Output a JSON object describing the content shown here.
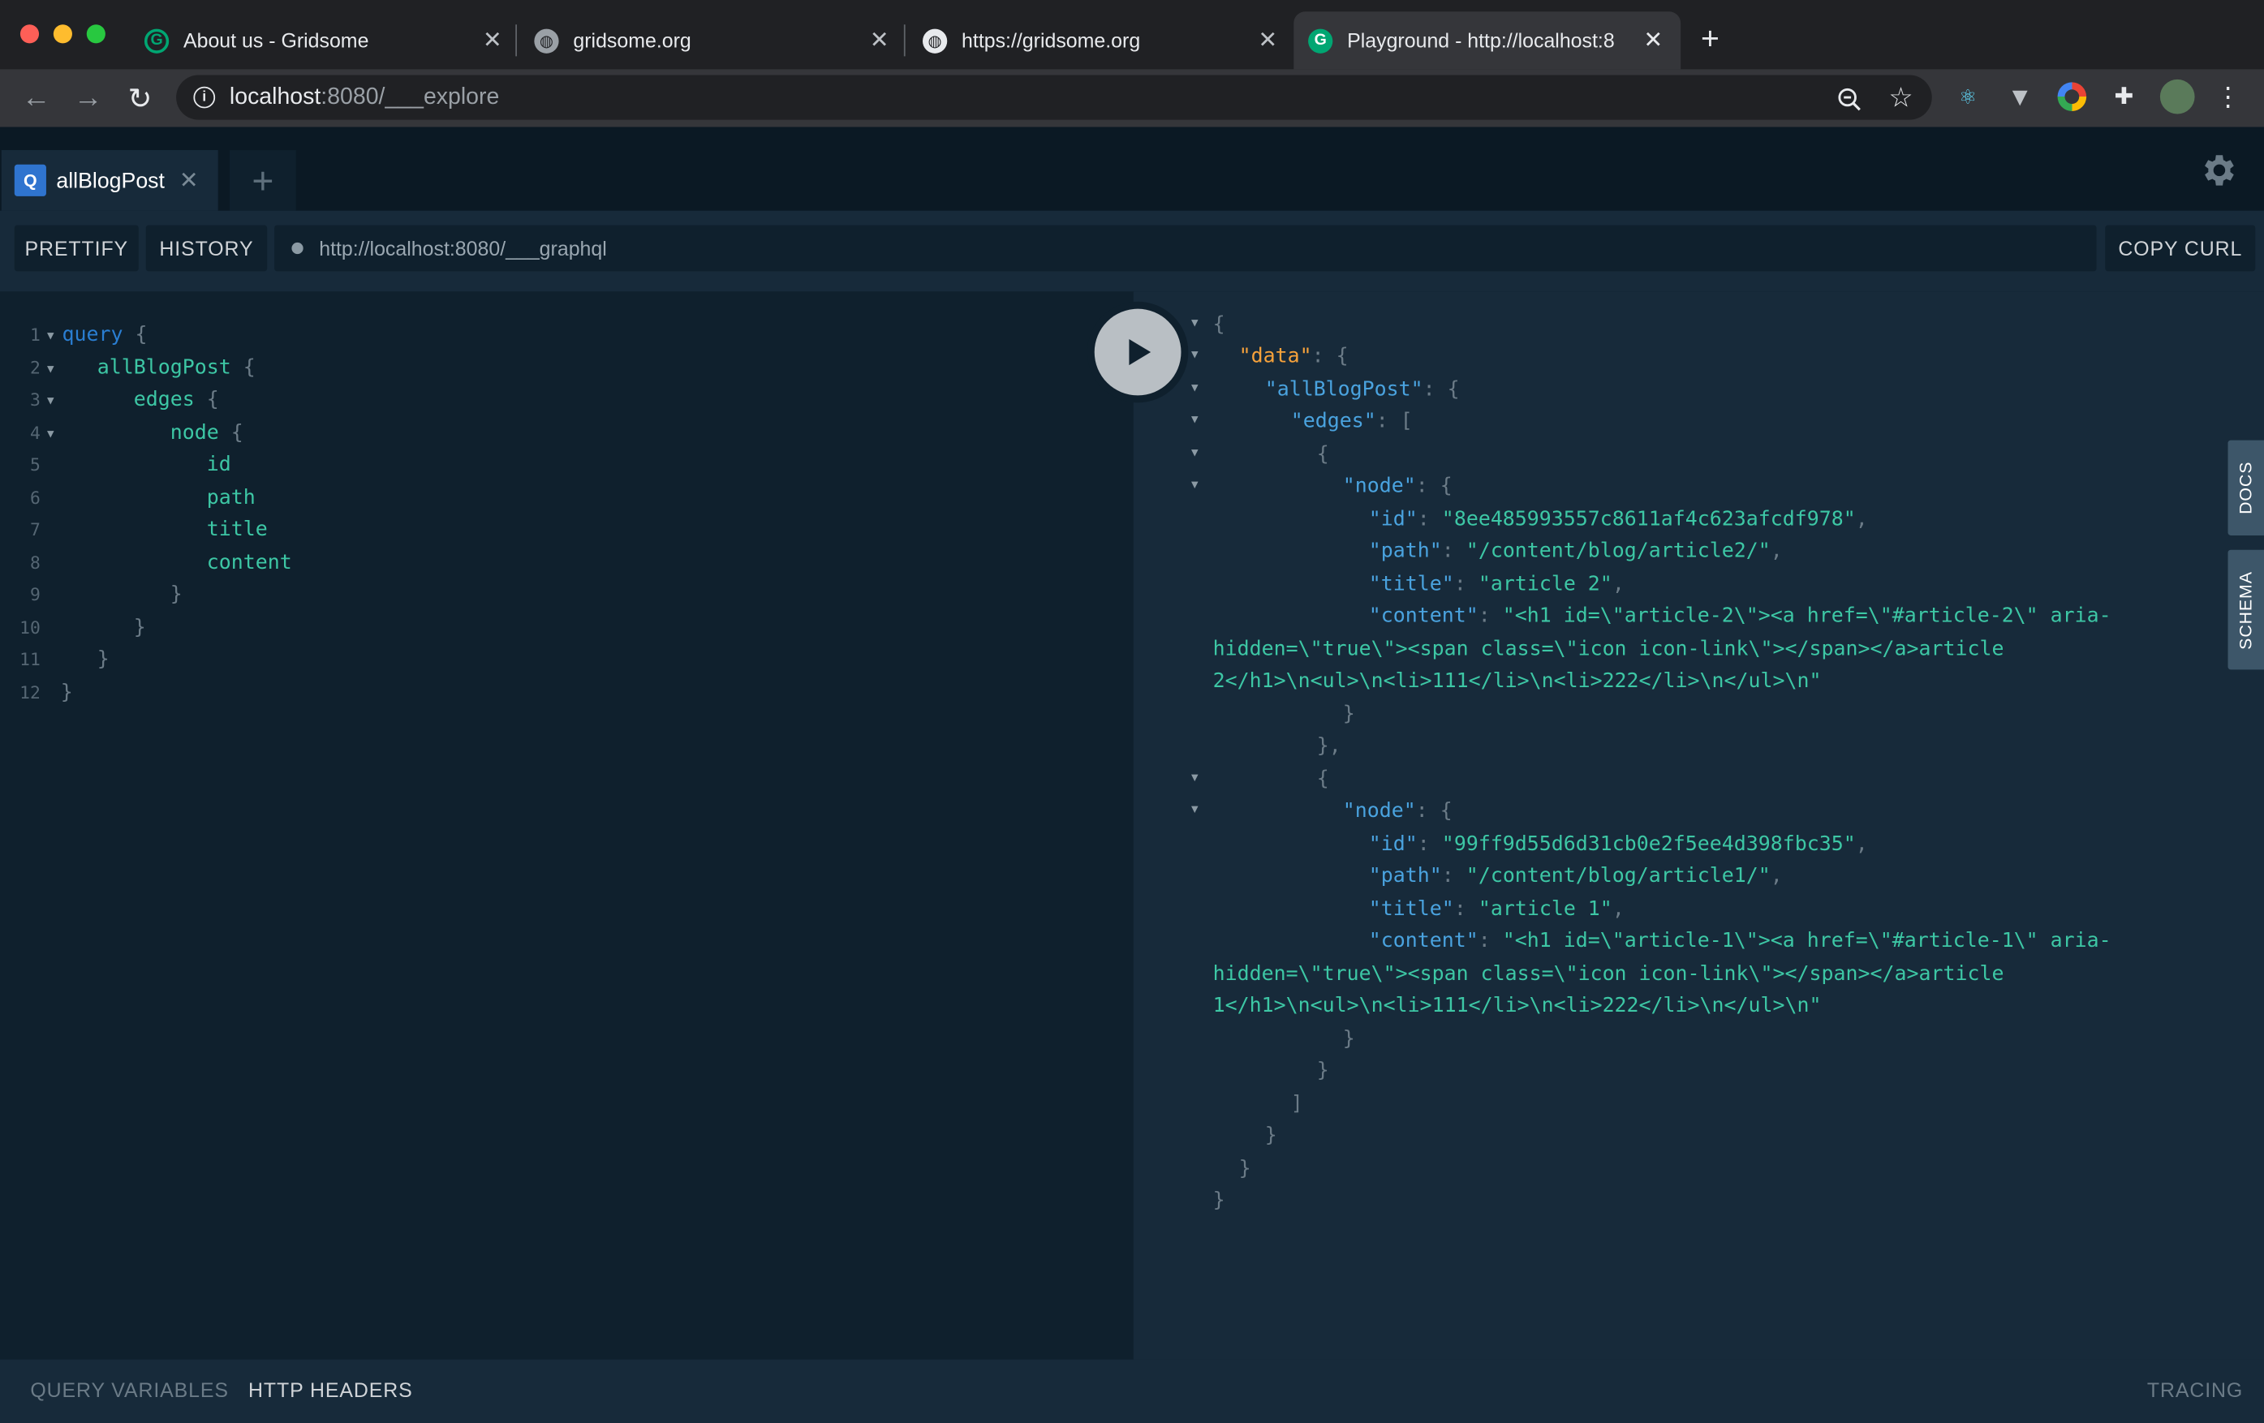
{
  "browser": {
    "tabs": [
      {
        "title": "About us - Gridsome",
        "icon": "gridsome-icon"
      },
      {
        "title": "gridsome.org",
        "icon": "globe-icon"
      },
      {
        "title": "https://gridsome.org",
        "icon": "globe-icon"
      },
      {
        "title": "Playground - http://localhost:8",
        "icon": "gridsome-icon"
      }
    ],
    "url_host": "localhost",
    "url_rest": ":8080/___explore"
  },
  "playground": {
    "tab_label": "allBlogPost",
    "tab_badge": "Q",
    "prettify": "PRETTIFY",
    "history": "HISTORY",
    "endpoint": "http://localhost:8080/___graphql",
    "copy_curl": "COPY CURL",
    "docs": "DOCS",
    "schema": "SCHEMA",
    "query_variables": "QUERY VARIABLES",
    "http_headers": "HTTP HEADERS",
    "tracing": "TRACING"
  },
  "query": {
    "line_numbers": [
      "1",
      "2",
      "3",
      "4",
      "5",
      "6",
      "7",
      "8",
      "9",
      "10",
      "11",
      "12"
    ],
    "kw_query": "query",
    "root_field": "allBlogPost",
    "edges": "edges",
    "node": "node",
    "fields": [
      "id",
      "path",
      "title",
      "content"
    ]
  },
  "result": {
    "edges": [
      {
        "id": "8ee485993557c8611af4c623afcdf978",
        "path": "/content/blog/article2/",
        "title": "article 2",
        "content_l1": "\"<h1 id=\\\"article-2\\\"><a href=\\\"#article-2\\\" aria-",
        "content_l2": "hidden=\\\"true\\\"><span class=\\\"icon icon-link\\\"></span></a>article",
        "content_l3": "2</h1>\\n<ul>\\n<li>111</li>\\n<li>222</li>\\n</ul>\\n\""
      },
      {
        "id": "99ff9d55d6d31cb0e2f5ee4d398fbc35",
        "path": "/content/blog/article1/",
        "title": "article 1",
        "content_l1": "\"<h1 id=\\\"article-1\\\"><a href=\\\"#article-1\\\" aria-",
        "content_l2": "hidden=\\\"true\\\"><span class=\\\"icon icon-link\\\"></span></a>article",
        "content_l3": "1</h1>\\n<ul>\\n<li>111</li>\\n<li>222</li>\\n</ul>\\n\""
      }
    ]
  }
}
